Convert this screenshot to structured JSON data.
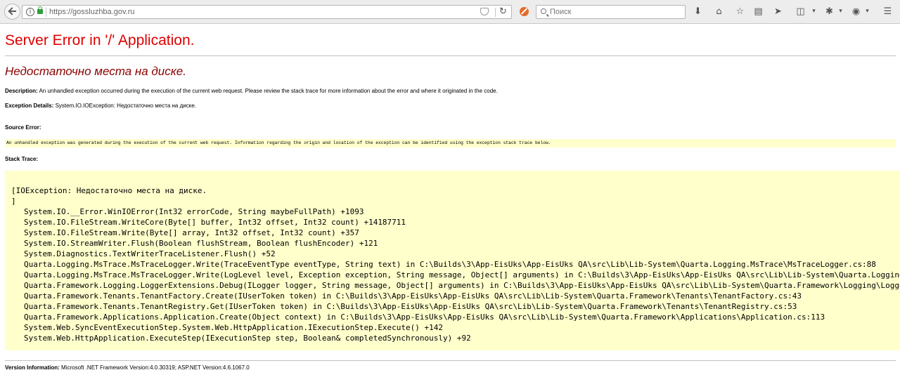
{
  "browser": {
    "url": "https://gossluzhba.gov.ru",
    "search_placeholder": "Поиск",
    "info_glyph": "i"
  },
  "page": {
    "title": "Server Error in '/' Application.",
    "subtitle": "Недостаточно места на диске.",
    "description_label": "Description:",
    "description_text": "An unhandled exception occurred during the execution of the current web request. Please review the stack trace for more information about the error and where it originated in the code.",
    "exception_label": "Exception Details:",
    "exception_text": "System.IO.IOException: Недостаточно места на диске.",
    "source_error_label": "Source Error:",
    "source_error_text": "An unhandled exception was generated during the execution of the current web request. Information regarding the origin and location of the exception can be identified using the exception stack trace below.",
    "stack_trace_label": "Stack Trace:",
    "stack_trace": [
      "[IOException: Недостаточно места на диске.",
      "]",
      "System.IO.__Error.WinIOError(Int32 errorCode, String maybeFullPath) +1093",
      "System.IO.FileStream.WriteCore(Byte[] buffer, Int32 offset, Int32 count) +14187711",
      "System.IO.FileStream.Write(Byte[] array, Int32 offset, Int32 count) +357",
      "System.IO.StreamWriter.Flush(Boolean flushStream, Boolean flushEncoder) +121",
      "System.Diagnostics.TextWriterTraceListener.Flush() +52",
      "Quarta.Logging.MsTrace.MsTraceLogger.Write(TraceEventType eventType, String text) in C:\\Builds\\3\\App-EisUks\\App-EisUks QA\\src\\Lib\\Lib-System\\Quarta.Logging.MsTrace\\MsTraceLogger.cs:88",
      "Quarta.Logging.MsTrace.MsTraceLogger.Write(LogLevel level, Exception exception, String message, Object[] arguments) in C:\\Builds\\3\\App-EisUks\\App-EisUks QA\\src\\Lib\\Lib-System\\Quarta.Logging.MsTr",
      "Quarta.Framework.Logging.LoggerExtensions.Debug(ILogger logger, String message, Object[] arguments) in C:\\Builds\\3\\App-EisUks\\App-EisUks QA\\src\\Lib\\Lib-System\\Quarta.Framework\\Logging\\LoggerExte",
      "Quarta.Framework.Tenants.TenantFactory.Create(IUserToken token) in C:\\Builds\\3\\App-EisUks\\App-EisUks QA\\src\\Lib\\Lib-System\\Quarta.Framework\\Tenants\\TenantFactory.cs:43",
      "Quarta.Framework.Tenants.TenantRegistry.Get(IUserToken token) in C:\\Builds\\3\\App-EisUks\\App-EisUks QA\\src\\Lib\\Lib-System\\Quarta.Framework\\Tenants\\TenantRegistry.cs:53",
      "Quarta.Framework.Applications.Application.Create(Object context) in C:\\Builds\\3\\App-EisUks\\App-EisUks QA\\src\\Lib\\Lib-System\\Quarta.Framework\\Applications\\Application.cs:113",
      "System.Web.SyncEventExecutionStep.System.Web.HttpApplication.IExecutionStep.Execute() +142",
      "System.Web.HttpApplication.ExecuteStep(IExecutionStep step, Boolean& completedSynchronously) +92"
    ],
    "version_label": "Version Information:",
    "version_text": "Microsoft .NET Framework Version:4.0.30319; ASP.NET Version:4.6.1067.0"
  }
}
